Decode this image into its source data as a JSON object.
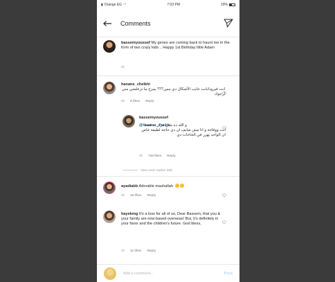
{
  "status": {
    "carrier": "Orange EG",
    "time": "7:03 PM",
    "battery": "29%"
  },
  "header": {
    "title": "Comments",
    "back_icon": "back-arrow-icon",
    "send_icon": "send-icon"
  },
  "caption": {
    "username": "bassemyoussef",
    "text": "My genes are coming back to haunt me in the form of two crazy kids .. Happy 1st Birthday little Adam",
    "time": "2h"
  },
  "comments": [
    {
      "username": "hanane_cheikhi",
      "text": "انت فيروذابانت جايب الأشكال دي منين؟؟؟ يمزح ما تزعلشي مني أرجوك",
      "time": "2h",
      "likes": "8 likes",
      "reply": "Reply"
    },
    {
      "username": "bassemyoussef",
      "mention": "@hanane_cheikhi",
      "text": "و الله ده مش هزار ده فقط انت ووقاحة و انا مش شايف ان دي حاجة لطيفة خاص ان الواحد يهزر في الحاجات دي",
      "time": "2h",
      "likes": "749 likes",
      "reply": "Reply"
    },
    {
      "username": "ayadiabb",
      "text": "Adorable mashallah",
      "time": "2h",
      "likes": "16 likes",
      "reply": "Reply"
    },
    {
      "username": "hayekmg",
      "text": "It's a loss for all of us, Dear Bassem, that you & your family are now based overseas! But, it's definitely in your favor and the children's future. God bless,",
      "time": "2h",
      "likes": "11 likes",
      "reply": "Reply"
    }
  ],
  "view_more": "View more replies (89)",
  "footer": {
    "placeholder": "Add a comment...",
    "post": "Post"
  },
  "colors": {
    "post_disabled": "#b3d7f5",
    "meta": "#999999",
    "story_ring": "#e84f7c"
  }
}
